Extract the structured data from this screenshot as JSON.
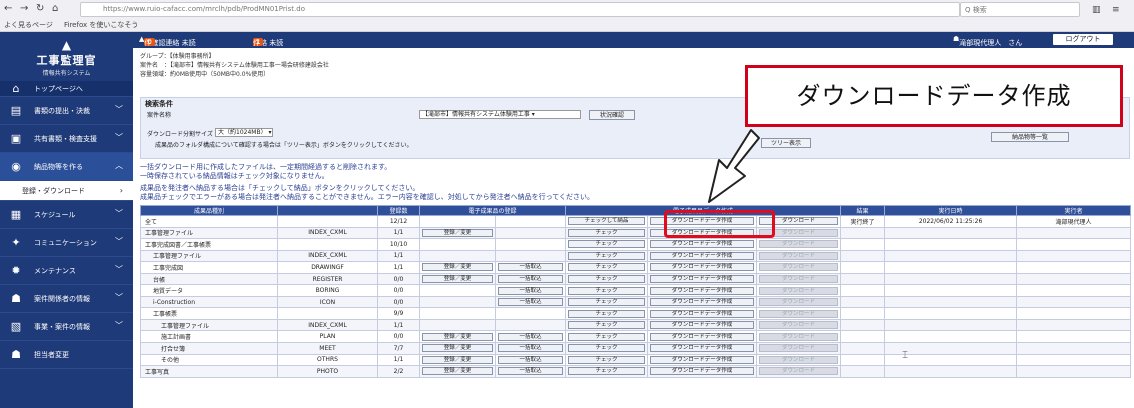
{
  "browser": {
    "url": "https://www.ruio-cafacc.com/mrclh/pdb/ProdMN01Prist.do",
    "search_placeholder": "Q 検索",
    "bookmarks": [
      "よく見るページ",
      "Firefox を使いこなそう"
    ]
  },
  "app": {
    "title": "工事監理官",
    "subtitle": "情報共有システム"
  },
  "header": {
    "unread_label": "未確認連絡 未読",
    "unread_count": "0",
    "unread_unit": "件",
    "notice_label": "連絡 未読",
    "notice_count": "1",
    "notice_unit": "件",
    "user": "滝部現代理人　さん",
    "logout": "ログアウト"
  },
  "sidebar": {
    "items": [
      {
        "label": "トップページへ",
        "icon": "home-icon"
      },
      {
        "label": "書類の提出・決裁",
        "icon": "document-icon"
      },
      {
        "label": "共有書類・検査支援",
        "icon": "folder-icon"
      },
      {
        "label": "納品物等を作る",
        "icon": "delivery-icon"
      },
      {
        "label": "登録・ダウンロード",
        "icon": "arrow-icon"
      },
      {
        "label": "スケジュール",
        "icon": "calendar-icon"
      },
      {
        "label": "コミュニケーション",
        "icon": "handshake-icon"
      },
      {
        "label": "メンテナンス",
        "icon": "gear-icon"
      },
      {
        "label": "案件関係者の情報",
        "icon": "people-icon"
      },
      {
        "label": "事業・案件の情報",
        "icon": "report-icon"
      },
      {
        "label": "担当者変更",
        "icon": "people-icon"
      }
    ]
  },
  "info": {
    "group": "グループ：【体験用事務所】",
    "project": "案件名　：【滝部市】情報共有システム体験用工事一場会研修建設会社",
    "capacity": "容量領域：約0MB使用中（50MB中0.0%使用）"
  },
  "search": {
    "section_title": "検索条件",
    "project_label": "案件名称",
    "project_value": "【滝部市】情報共有システム体験用工事",
    "status_button": "状況確認",
    "split_label": "ダウンロード分割サイズ",
    "split_value": "大（約1024MB）",
    "folder_hint": "成果品のフォルダ構成について確認する場合は「ツリー表示」ボタンをクリックしてください。",
    "tree_button": "ツリー表示",
    "list_button": "納品物等一覧"
  },
  "notes": {
    "line1": "一括ダウンロード用に作成したファイルは、一定期間経過すると削除されます。",
    "line2": "一時保存されている納品情報はチェック対象になりません。",
    "line3": "成果品を発注者へ納品する場合は「チェックして納品」ボタンをクリックしてください。",
    "line4": "成果品チェックでエラーがある場合は発注者へ納品することができません。エラー内容を確認し、対処してから発注者へ納品を行ってください。"
  },
  "callout": "ダウンロードデータ作成",
  "table": {
    "headers": [
      "成果品種別",
      "",
      "登録数",
      "電子成果品の登録",
      "",
      "電子成果品データ作成",
      "",
      "",
      "結果",
      "実行日時",
      "実行者"
    ],
    "check_and_deliver": "チェックして納品",
    "btn_create": "ダウンロードデータ作成",
    "btn_download": "ダウンロード",
    "btn_check": "チェック",
    "btn_register": "登録／変更",
    "btn_bulk": "一括取込",
    "rows": [
      {
        "name": "全て",
        "code": "",
        "count": "12/12",
        "reg": false,
        "bulk": false,
        "result": "実行終了",
        "date": "2022/06/02 11:25:26",
        "user": "滝部現代理人"
      },
      {
        "name": "工事管理ファイル",
        "code": "INDEX_CXML",
        "count": "1/1",
        "reg": true,
        "bulk": false,
        "result": "",
        "date": "",
        "user": ""
      },
      {
        "name": "工事完成図書／工事帳票",
        "code": "",
        "count": "10/10",
        "reg": false,
        "bulk": false,
        "result": "",
        "date": "",
        "user": ""
      },
      {
        "name": "工事管理ファイル",
        "code": "INDEX_CXML",
        "count": "1/1",
        "reg": false,
        "bulk": false,
        "result": "",
        "date": "",
        "user": ""
      },
      {
        "name": "工事完成図",
        "code": "DRAWINGF",
        "count": "1/1",
        "reg": true,
        "bulk": true,
        "result": "",
        "date": "",
        "user": ""
      },
      {
        "name": "台帳",
        "code": "REGISTER",
        "count": "0/0",
        "reg": true,
        "bulk": true,
        "result": "",
        "date": "",
        "user": ""
      },
      {
        "name": "地質データ",
        "code": "BORING",
        "count": "0/0",
        "reg": false,
        "bulk": true,
        "result": "",
        "date": "",
        "user": ""
      },
      {
        "name": "i-Construction",
        "code": "ICON",
        "count": "0/0",
        "reg": false,
        "bulk": true,
        "result": "",
        "date": "",
        "user": ""
      },
      {
        "name": "工事帳票",
        "code": "",
        "count": "9/9",
        "reg": false,
        "bulk": false,
        "result": "",
        "date": "",
        "user": ""
      },
      {
        "name": "工事管理ファイル",
        "code": "INDEX_CXML",
        "count": "1/1",
        "reg": false,
        "bulk": false,
        "result": "",
        "date": "",
        "user": ""
      },
      {
        "name": "施工計画書",
        "code": "PLAN",
        "count": "0/0",
        "reg": true,
        "bulk": true,
        "result": "",
        "date": "",
        "user": ""
      },
      {
        "name": "打合せ簿",
        "code": "MEET",
        "count": "7/7",
        "reg": true,
        "bulk": true,
        "result": "",
        "date": "",
        "user": ""
      },
      {
        "name": "その他",
        "code": "OTHRS",
        "count": "1/1",
        "reg": true,
        "bulk": true,
        "result": "",
        "date": "",
        "user": ""
      },
      {
        "name": "工事写真",
        "code": "PHOTO",
        "count": "2/2",
        "reg": true,
        "bulk": true,
        "result": "",
        "date": "",
        "user": ""
      }
    ]
  }
}
